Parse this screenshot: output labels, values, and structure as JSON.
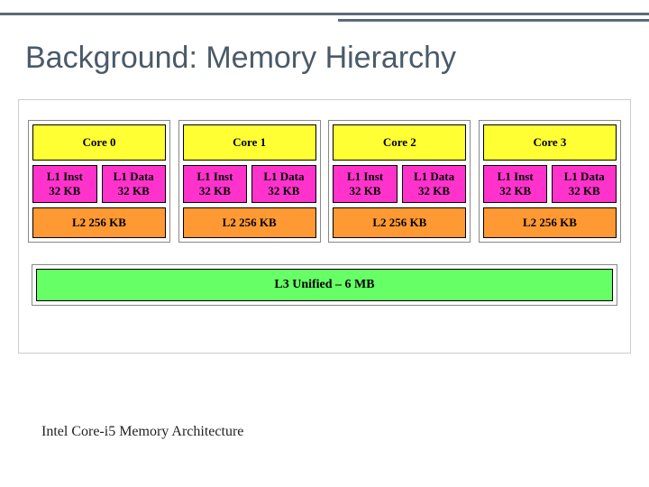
{
  "slide": {
    "title": "Background: Memory Hierarchy",
    "caption": "Intel Core-i5 Memory Architecture"
  },
  "cores": [
    {
      "core_label": "Core 0",
      "l1_inst": "L1 Inst\n32 KB",
      "l1_data": "L1 Data\n32 KB",
      "l2": "L2 256 KB"
    },
    {
      "core_label": "Core 1",
      "l1_inst": "L1 Inst\n32 KB",
      "l1_data": "L1 Data\n32 KB",
      "l2": "L2 256 KB"
    },
    {
      "core_label": "Core 2",
      "l1_inst": "L1 Inst\n32 KB",
      "l1_data": "L1 Data\n32 KB",
      "l2": "L2 256 KB"
    },
    {
      "core_label": "Core 3",
      "l1_inst": "L1 Inst\n32 KB",
      "l1_data": "L1 Data\n32 KB",
      "l2": "L2 256 KB"
    }
  ],
  "l3": {
    "label": "L3 Unified – 6 MB"
  },
  "colors": {
    "core": "#ffff33",
    "l1": "#ff33cc",
    "l2": "#ff9933",
    "l3": "#66ff66",
    "rule": "#5b6b78"
  }
}
